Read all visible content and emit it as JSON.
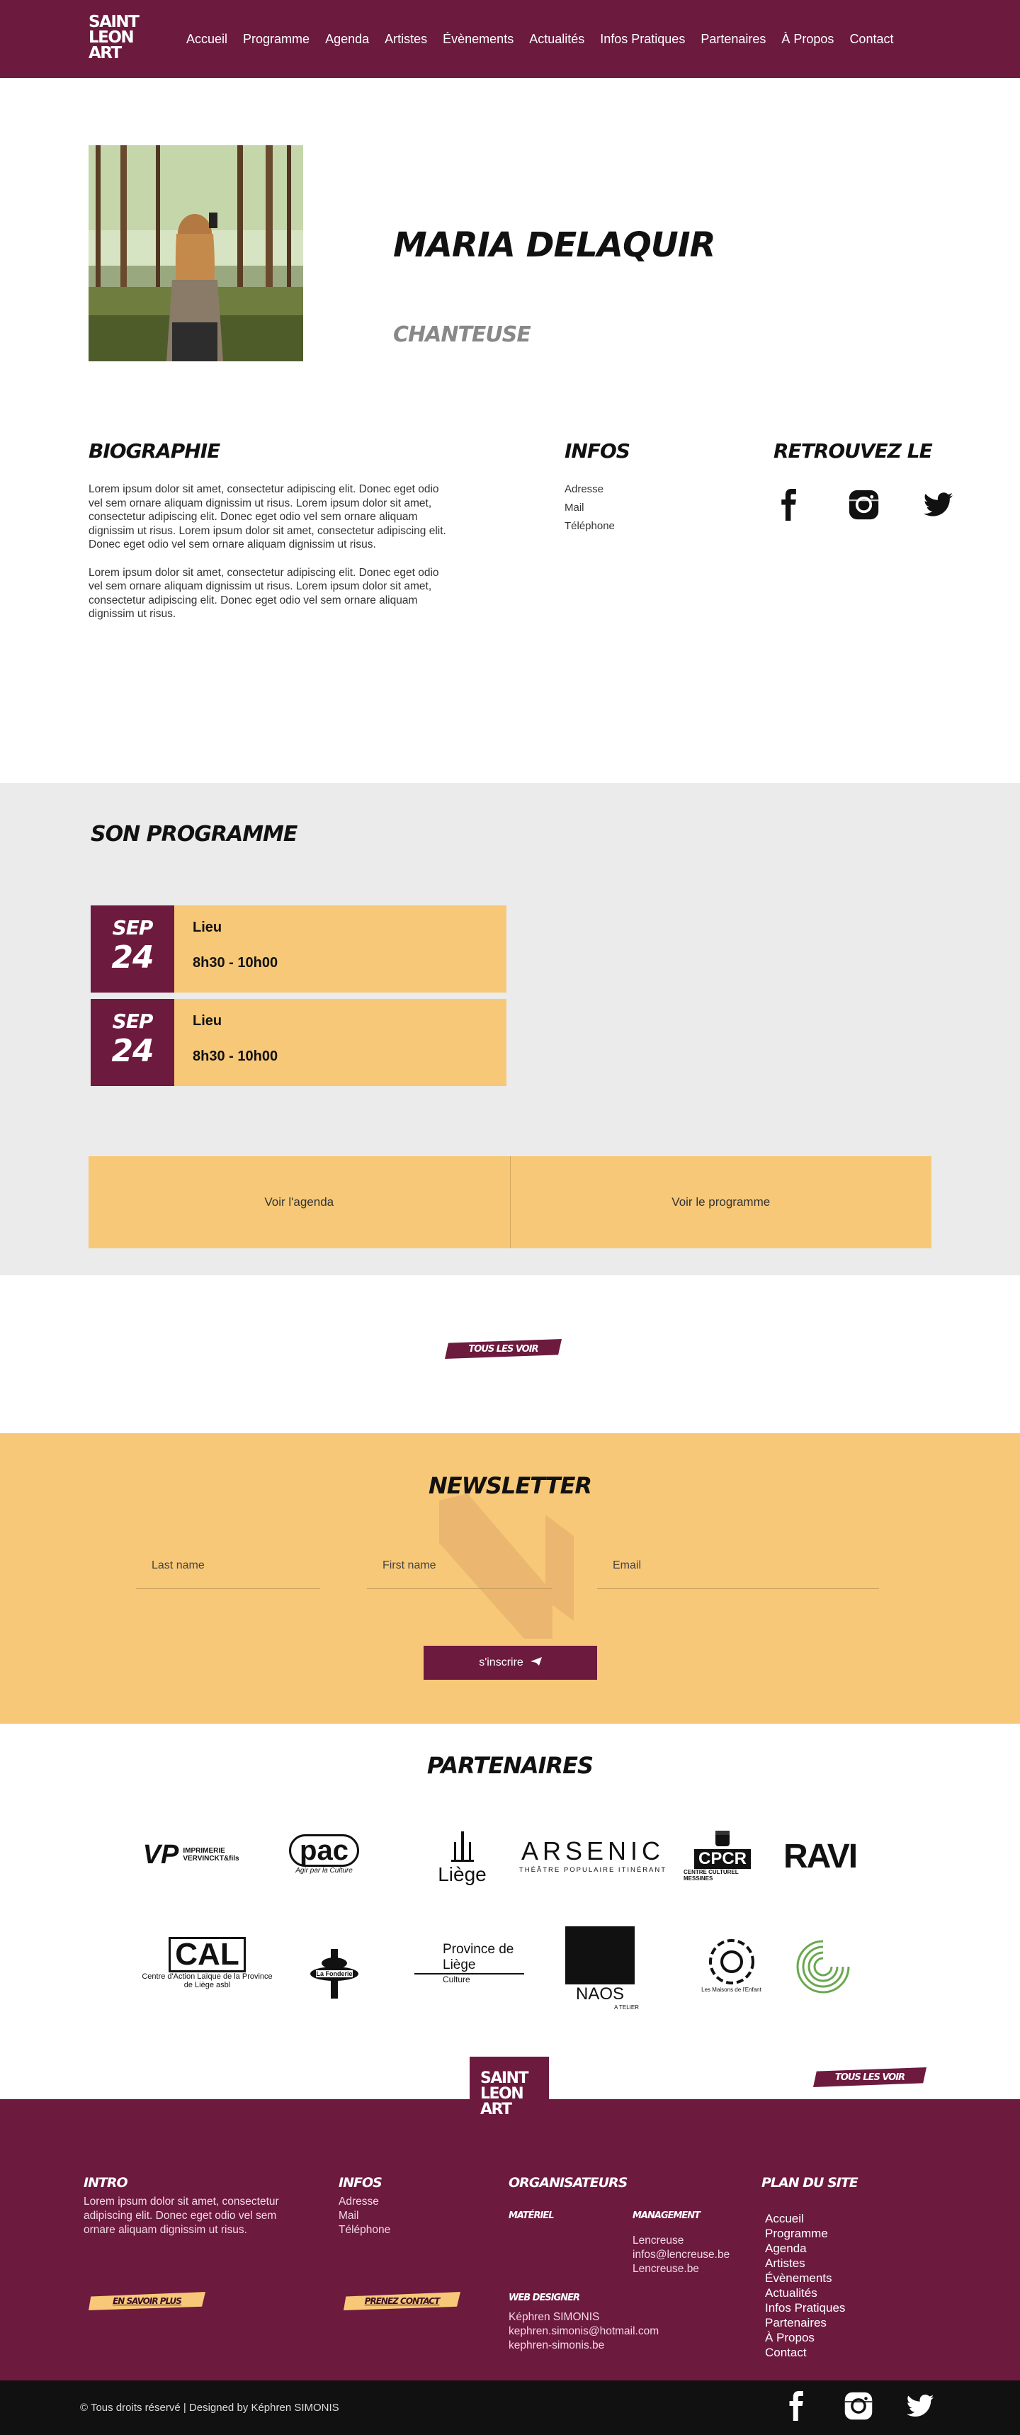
{
  "header": {
    "logo_lines": [
      "SAINT",
      "LEON",
      "ART"
    ],
    "nav": [
      "Accueil",
      "Programme",
      "Agenda",
      "Artistes",
      "Évènements",
      "Actualités",
      "Infos Pratiques",
      "Partenaires",
      "À Propos",
      "Contact"
    ]
  },
  "artist": {
    "name": "MARIA DELAQUIR",
    "role": "CHANTEUSE"
  },
  "bio": {
    "title": "BIOGRAPHIE",
    "paragraphs": [
      "Lorem ipsum dolor sit amet, consectetur adipiscing elit. Donec eget odio vel sem ornare aliquam dignissim ut risus. Lorem ipsum dolor sit amet, consectetur adipiscing elit. Donec eget odio vel sem ornare aliquam dignissim ut risus. Lorem ipsum dolor sit amet, consectetur adipiscing elit. Donec eget odio vel sem ornare aliquam dignissim ut risus.",
      "Lorem ipsum dolor sit amet, consectetur adipiscing elit. Donec eget odio vel sem ornare aliquam dignissim ut risus. Lorem ipsum dolor sit amet, consectetur adipiscing elit. Donec eget odio vel sem ornare aliquam dignissim ut risus."
    ]
  },
  "infos": {
    "title": "INFOS",
    "items": [
      "Adresse",
      "Mail",
      "Téléphone"
    ]
  },
  "find": {
    "title": "RETROUVEZ LE"
  },
  "programme": {
    "title": "SON PROGRAMME",
    "events": [
      {
        "month": "SEP",
        "day": "24",
        "place": "Lieu",
        "time": "8h30 - 10h00"
      },
      {
        "month": "SEP",
        "day": "24",
        "place": "Lieu",
        "time": "8h30 - 10h00"
      }
    ],
    "links": [
      "Voir l'agenda",
      "Voir le programme"
    ]
  },
  "see_all": "TOUS LES VOIR",
  "newsletter": {
    "title": "NEWSLETTER",
    "last_name": "Last name",
    "first_name": "First name",
    "email": "Email",
    "submit": "s'inscrire"
  },
  "partners": {
    "title": "PARTENAIRES",
    "logos": [
      {
        "top": "VP",
        "bottom": "IMPRIMERIE VERVINCKT&fils"
      },
      {
        "top": "pac",
        "bottom": "Agir par la Culture"
      },
      {
        "top": "Liège",
        "bottom": ""
      },
      {
        "top": "ARSENIC",
        "bottom": "THÉÂTRE POPULAIRE ITINÉRANT"
      },
      {
        "top": "CPCR",
        "bottom": "CENTRE CULTUREL MESSINES"
      },
      {
        "top": "RAVI",
        "bottom": ""
      },
      {
        "top": "CAL",
        "bottom": "Centre d'Action Laïque de la Province de Liège asbl"
      },
      {
        "top": "",
        "bottom": "La Fonderie"
      },
      {
        "top": "Province de Liège",
        "bottom": "Culture"
      },
      {
        "top": "NAOS",
        "bottom": "A TELIER"
      },
      {
        "top": "",
        "bottom": "Les Maisons de l'Enfant"
      },
      {
        "top": "",
        "bottom": ""
      }
    ]
  },
  "footer": {
    "logo_lines": [
      "SAINT",
      "LEON",
      "ART"
    ],
    "intro_title": "INTRO",
    "intro_text": "Lorem ipsum dolor sit amet, consectetur adipiscing elit. Donec eget odio vel sem ornare aliquam dignissim ut risus.",
    "intro_button": "EN SAVOIR PLUS",
    "infos_title": "INFOS",
    "infos_items": [
      "Adresse",
      "Mail",
      "Téléphone"
    ],
    "infos_button": "PRENEZ CONTACT",
    "orga_title": "ORGANISATEURS",
    "material_title": "MATÉRIEL",
    "management_title": "MANAGEMENT",
    "management_items": [
      "Lencreuse",
      "infos@lencreuse.be",
      "Lencreuse.be"
    ],
    "webdesigner_title": "WEB DESIGNER",
    "webdesigner_items": [
      "Képhren SIMONIS",
      "kephren.simonis@hotmail.com",
      "kephren-simonis.be"
    ],
    "sitemap_title": "PLAN DU SITE",
    "sitemap": [
      "Accueil",
      "Programme",
      "Agenda",
      "Artistes",
      "Évènements",
      "Actualités",
      "Infos Pratiques",
      "Partenaires",
      "À Propos",
      "Contact"
    ]
  },
  "bottom": {
    "copyright": "© Tous droits réservé | Designed by Képhren SIMONIS"
  },
  "colors": {
    "primary": "#6d1a3f",
    "accent": "#f7c878",
    "grey_band": "#ebebeb",
    "dark": "#111111"
  },
  "icons": [
    "facebook-icon",
    "instagram-icon",
    "twitter-icon",
    "send-icon"
  ]
}
